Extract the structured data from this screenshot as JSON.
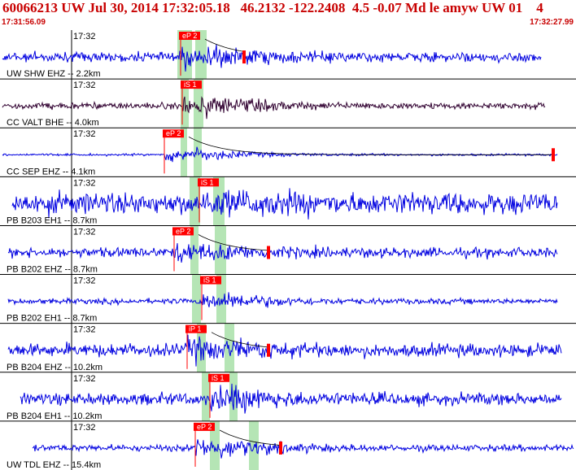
{
  "header": {
    "title": "60066213 UW Jul 30, 2014 17:32:05.18   46.2132 -122.2408  4.5 -0.07 Md le amyw UW 01    4",
    "start_time": "17:31:56.09",
    "end_time": "17:32:27.99"
  },
  "colors": {
    "trace_blue": "#0000e0",
    "trace_dark": "#300030",
    "pick_red": "#ff0000",
    "window_green": "#a8e0a8",
    "grid_line": "#000000",
    "header_text": "#c80000"
  },
  "chart_data": {
    "type": "line",
    "time_range": [
      "17:31:56.09",
      "17:32:27.99"
    ],
    "tick_label": "17:32",
    "traces": [
      {
        "station": "UW SHW EHZ -- 2.2km",
        "pick": "eP 2",
        "pick2": "",
        "color": "#0000e0"
      },
      {
        "station": "CC VALT BHE -- 4.0km",
        "pick": "iS 1",
        "pick2": "",
        "color": "#300030"
      },
      {
        "station": "CC SEP EHZ -- 4.1km",
        "pick": "eP 2",
        "pick2": "",
        "color": "#0000e0"
      },
      {
        "station": "PB B203 EH1 -- 8.7km",
        "pick": "iS 1",
        "pick2": "",
        "color": "#0000e0"
      },
      {
        "station": "PB B202 EHZ -- 8.7km",
        "pick": "eP 2",
        "pick2": "",
        "color": "#0000e0"
      },
      {
        "station": "PB B202 EH1 -- 8.7km",
        "pick": "iS 1",
        "pick2": "",
        "color": "#0000e0"
      },
      {
        "station": "PB B204 EHZ -- 10.2km",
        "pick": "iP 1",
        "pick2": "",
        "color": "#0000e0"
      },
      {
        "station": "PB B204 EH1 -- 10.2km",
        "pick": "iS 1",
        "pick2": "",
        "color": "#0000e0"
      },
      {
        "station": "UW TDL EHZ -- 15.4km",
        "pick": "eP 2",
        "pick2": "",
        "color": "#0000e0"
      }
    ]
  }
}
